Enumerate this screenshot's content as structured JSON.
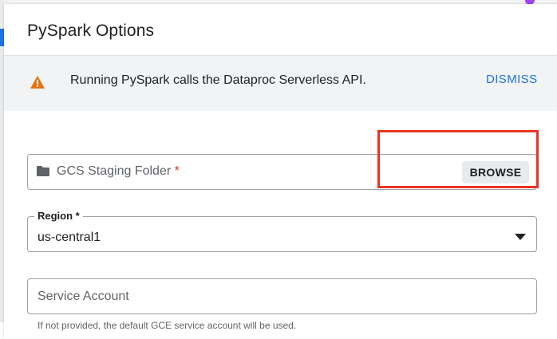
{
  "dialog": {
    "title": "PySpark Options"
  },
  "banner": {
    "icon": "warning-icon",
    "message": "Running PySpark calls the Dataproc Serverless API.",
    "dismiss_label": "DISMISS",
    "warning_color": "#e8710a",
    "link_color": "#1a73e8"
  },
  "fields": {
    "gcs_staging": {
      "icon": "folder-icon",
      "label": "GCS Staging Folder",
      "required_mark": "*",
      "browse_label": "BROWSE"
    },
    "region": {
      "label": "Region *",
      "value": "us-central1",
      "icon": "dropdown-arrow-icon"
    },
    "service_account": {
      "label": "Service Account",
      "helper": "If not provided, the default GCE service account will be used."
    }
  },
  "annotation": {
    "highlight_color": "#ea3323"
  }
}
